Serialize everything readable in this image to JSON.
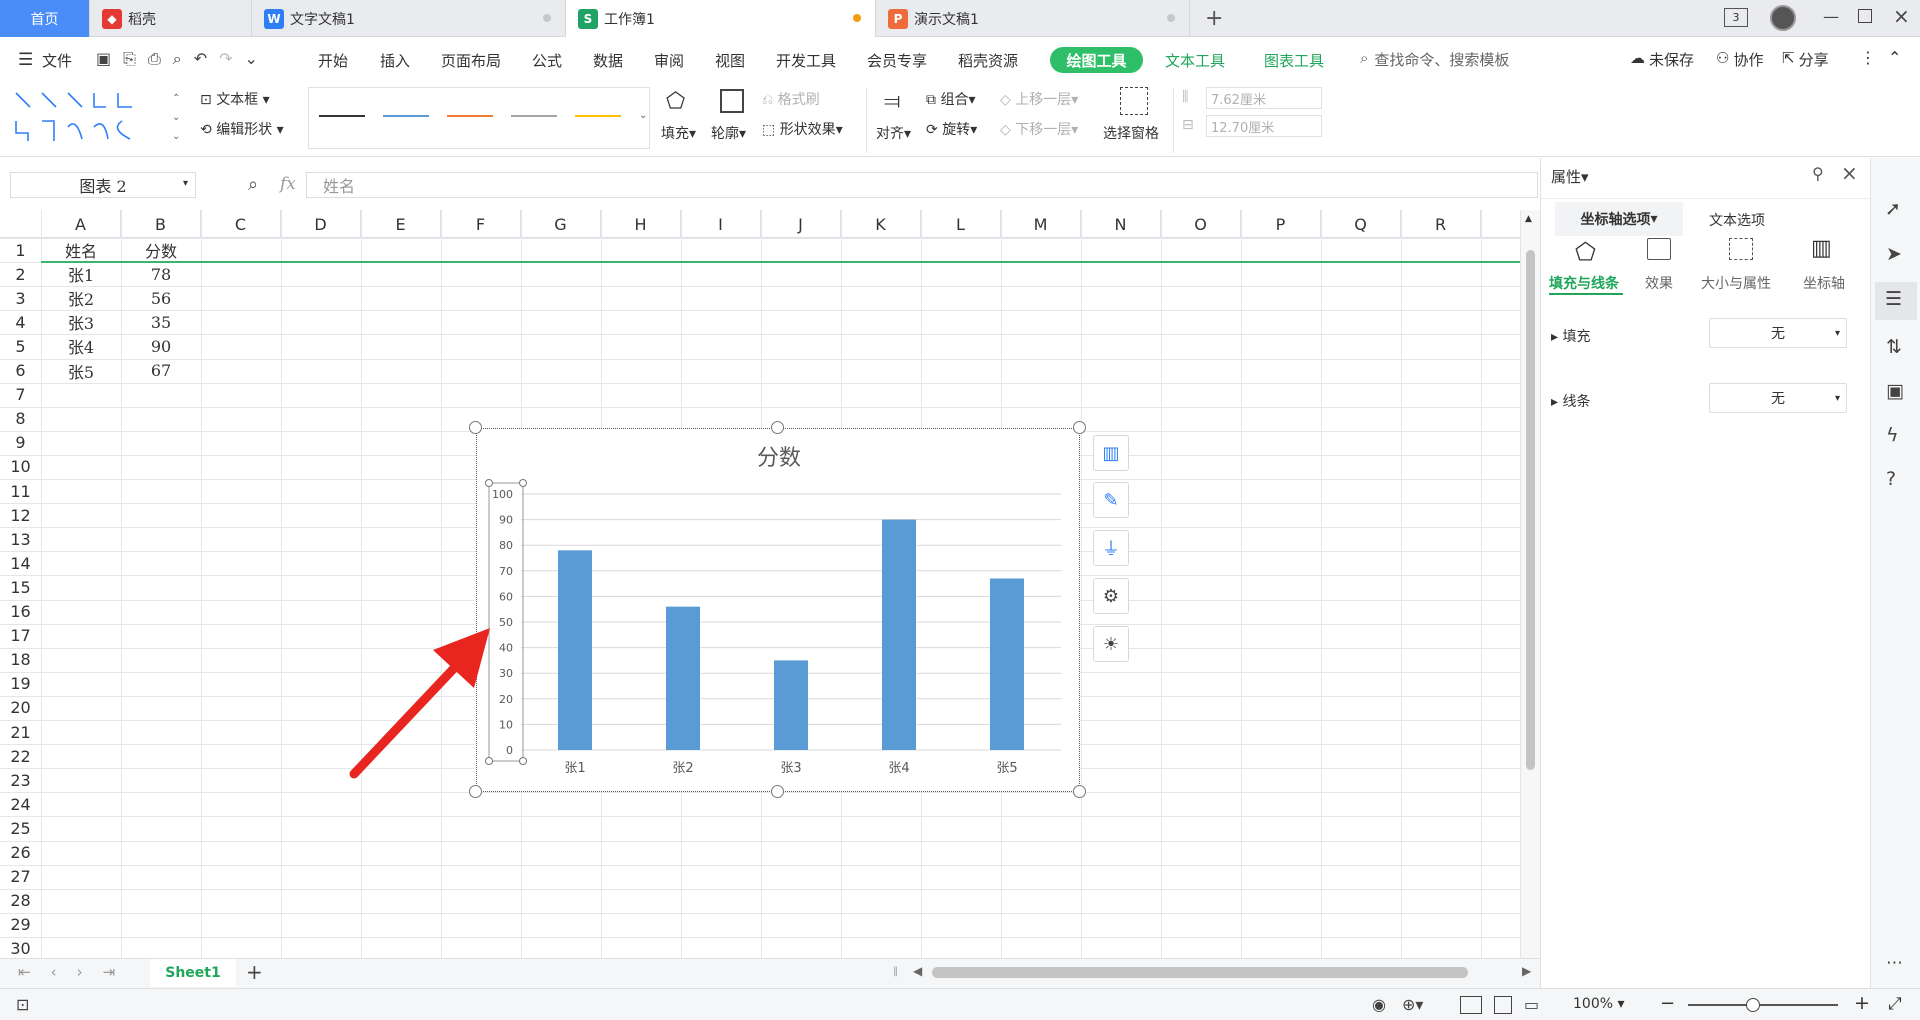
{
  "tabs": {
    "home": "首页",
    "items": [
      {
        "label": "稻壳",
        "icon": "docer-icon"
      },
      {
        "label": "文字文稿1",
        "icon": "writer-icon"
      },
      {
        "label": "工作簿1",
        "icon": "spreadsheet-icon"
      },
      {
        "label": "演示文稿1",
        "icon": "presentation-icon"
      }
    ],
    "window_count": "3"
  },
  "menu": {
    "file": "文件",
    "items": [
      "开始",
      "插入",
      "页面布局",
      "公式",
      "数据",
      "审阅",
      "视图",
      "开发工具",
      "会员专享",
      "稻壳资源"
    ],
    "drawing_tools": "绘图工具",
    "text_tools": "文本工具",
    "chart_tools": "图表工具",
    "search": "查找命令、搜索模板",
    "unsaved": "未保存",
    "collab": "协作",
    "share": "分享"
  },
  "ribbon": {
    "textbox": "文本框",
    "edit_shape": "编辑形状",
    "fill": "填充",
    "outline": "轮廓",
    "format_painter": "格式刷",
    "shape_effects": "形状效果",
    "align": "对齐",
    "group": "组合",
    "rotate": "旋转",
    "bring_forward": "上移一层",
    "send_backward": "下移一层",
    "selection_pane": "选择窗格",
    "height": "7.62厘米",
    "width": "12.70厘米"
  },
  "formula_bar": {
    "name_box": "图表 2",
    "fx": "fx",
    "content": "姓名"
  },
  "grid": {
    "columns": [
      "A",
      "B",
      "C",
      "D",
      "E",
      "F",
      "G",
      "H",
      "I",
      "J",
      "K",
      "L",
      "M",
      "N",
      "O",
      "P",
      "Q",
      "R"
    ],
    "rows": 30,
    "cells": [
      [
        "姓名",
        "分数"
      ],
      [
        "张1",
        "78"
      ],
      [
        "张2",
        "56"
      ],
      [
        "张3",
        "35"
      ],
      [
        "张4",
        "90"
      ],
      [
        "张5",
        "67"
      ]
    ]
  },
  "chart_data": {
    "type": "bar",
    "title": "分数",
    "categories": [
      "张1",
      "张2",
      "张3",
      "张4",
      "张5"
    ],
    "values": [
      78,
      56,
      35,
      90,
      67
    ],
    "ylim": [
      0,
      100
    ],
    "yticks": [
      "0",
      "10",
      "20",
      "30",
      "40",
      "50",
      "60",
      "70",
      "80",
      "90",
      "100"
    ],
    "grid": true,
    "bar_color": "#5b9bd5"
  },
  "panel": {
    "title": "属性",
    "tab_axis": "坐标轴选项",
    "tab_text": "文本选项",
    "subtabs": [
      "填充与线条",
      "效果",
      "大小与属性",
      "坐标轴"
    ],
    "fill_label": "填充",
    "fill_value": "无",
    "line_label": "线条",
    "line_value": "无"
  },
  "sheet": {
    "name": "Sheet1"
  },
  "status": {
    "zoom": "100%"
  },
  "colors": {
    "accent": "#2fbf68",
    "home_tab": "#4b8df8",
    "arrow": "#e8251f"
  }
}
